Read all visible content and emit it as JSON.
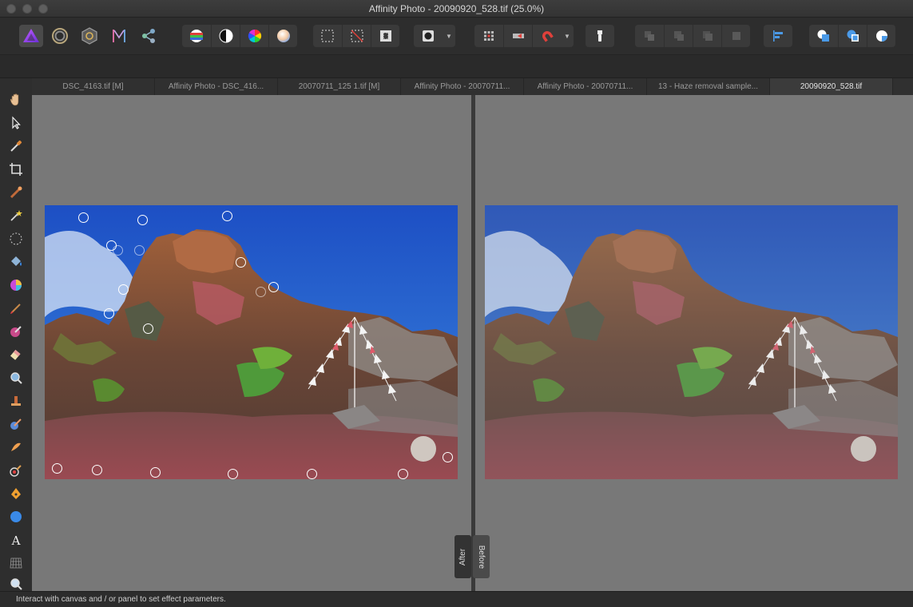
{
  "window": {
    "title": "Affinity Photo - 20090920_528.tif (25.0%)"
  },
  "toolbar": {
    "personas": [
      "photo-persona",
      "liquify-persona",
      "develop-persona",
      "tone-mapping-persona",
      "export-persona"
    ],
    "adjust_group": [
      "auto-levels",
      "auto-contrast",
      "auto-colour",
      "auto-white-balance"
    ],
    "selection_group": [
      "marquee",
      "deselect",
      "invert-selection"
    ],
    "mask_group": [
      "quick-mask"
    ],
    "snap_group": [
      "assistant",
      "snapping-toggle",
      "magnet"
    ],
    "arrange_group": [
      "move-to-back",
      "move-back",
      "move-forward",
      "move-to-front"
    ]
  },
  "tabs": [
    {
      "label": "DSC_4163.tif [M]",
      "active": false
    },
    {
      "label": "Affinity Photo - DSC_416...",
      "active": false
    },
    {
      "label": "20070711_125 1.tif [M]",
      "active": false
    },
    {
      "label": "Affinity Photo - 20070711...",
      "active": false
    },
    {
      "label": "Affinity Photo - 20070711...",
      "active": false
    },
    {
      "label": "13 - Haze removal sample...",
      "active": false
    },
    {
      "label": "20090920_528.tif",
      "active": true
    }
  ],
  "tools": [
    "view-tool",
    "move-tool",
    "colour-picker-tool",
    "crop-tool",
    "selection-brush-tool",
    "flood-select-tool",
    "marquee-tool",
    "flood-fill-tool",
    "gradient-tool",
    "paint-brush-tool",
    "clone-brush-tool",
    "erase-brush-tool",
    "dodge-brush-tool",
    "smudge-brush-tool",
    "blemish-tool",
    "inpainting-tool",
    "red-eye-tool",
    "pen-tool",
    "shape-tool",
    "text-tool",
    "mesh-warp-tool",
    "zoom-tool"
  ],
  "split_view": {
    "left_label": "After",
    "right_label": "Before"
  },
  "status": {
    "hint": "Interact with canvas and / or panel to set effect parameters."
  }
}
